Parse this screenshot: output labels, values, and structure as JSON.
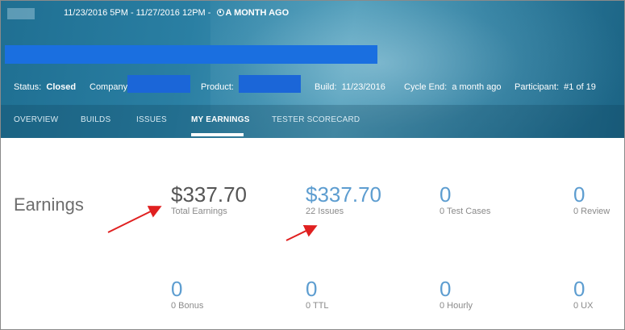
{
  "header": {
    "date_range": "11/23/2016 5PM - 11/27/2016 12PM -",
    "relative_time": "A MONTH AGO",
    "status_label": "Status:",
    "status_value": "Closed",
    "company_label": "Company",
    "product_label": "Product:",
    "build_label": "Build:",
    "build_value": "11/23/2016",
    "cycle_end_label": "Cycle End:",
    "cycle_end_value": "a month ago",
    "participant_label": "Participant:",
    "participant_value": "#1 of 19"
  },
  "tabs": [
    {
      "label": "OVERVIEW"
    },
    {
      "label": "BUILDS"
    },
    {
      "label": "ISSUES"
    },
    {
      "label": "MY EARNINGS"
    },
    {
      "label": "TESTER SCORECARD"
    }
  ],
  "earnings": {
    "title": "Earnings",
    "stats": [
      {
        "value": "$337.70",
        "label": "Total Earnings"
      },
      {
        "value": "$337.70",
        "label": "22 Issues"
      },
      {
        "value": "0",
        "label": "0 Test Cases"
      },
      {
        "value": "0",
        "label": "0 Review"
      },
      {
        "value": "0",
        "label": "0 Bonus"
      },
      {
        "value": "0",
        "label": "0 TTL"
      },
      {
        "value": "0",
        "label": "0 Hourly"
      },
      {
        "value": "0",
        "label": "0 UX"
      }
    ]
  },
  "colors": {
    "header_bg": "#2a7fa3",
    "accent_blue": "#5d9dd0",
    "redaction": "#1a6fe0",
    "arrow": "#e02020"
  }
}
